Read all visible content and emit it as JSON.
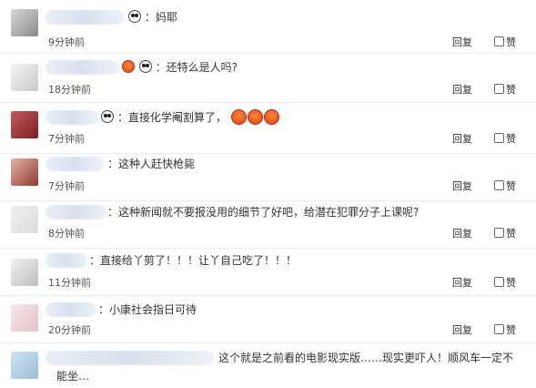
{
  "comments": [
    {
      "text": "：妈耶",
      "time": "9分钟前",
      "reply": "回复",
      "like": "赞"
    },
    {
      "text": "：还特么是人吗?",
      "time": "18分钟前",
      "reply": "回复",
      "like": "赞"
    },
    {
      "text": "：直接化学阉割算了，",
      "time": "7分钟前",
      "reply": "回复",
      "like": "赞"
    },
    {
      "text": "：这种人赶快枪毙",
      "time": "7分钟前",
      "reply": "回复",
      "like": "赞"
    },
    {
      "text": "：这种新闻就不要报没用的细节了好吧，给潜在犯罪分子上课呢?",
      "time": "8分钟前",
      "reply": "回复",
      "like": "赞"
    },
    {
      "text": "：直接给丫剪了！！！让丫自己吃了！！！",
      "time": "11分钟前",
      "reply": "回复",
      "like": "赞"
    },
    {
      "text": "：小康社会指日可待",
      "time": "20分钟前",
      "reply": "回复",
      "like": "赞"
    },
    {
      "text": "这个就是之前看的电影现实版……现实更吓人！顺风车一定不",
      "text2": "能坐…",
      "time": "",
      "reply": "",
      "like": ""
    }
  ],
  "icons": {
    "panda": "panda-emoji",
    "angry": "angry-face-emoji",
    "like": "thumbs-up-icon"
  }
}
